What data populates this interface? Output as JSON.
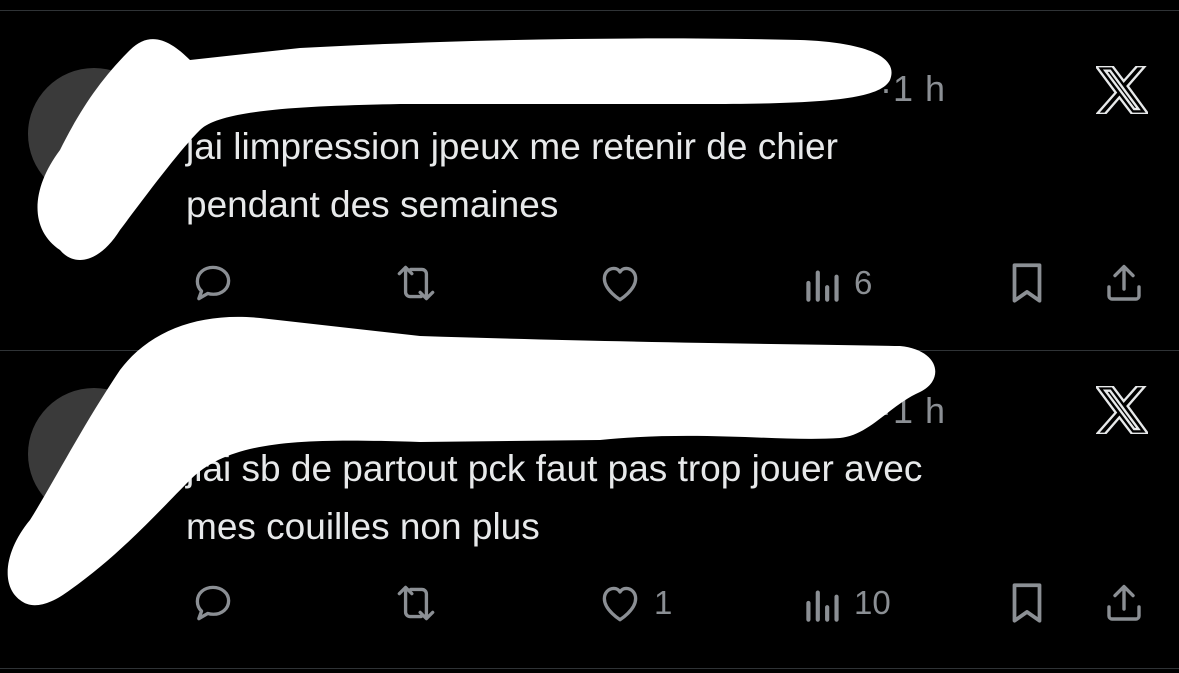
{
  "tweets": [
    {
      "time": "·1 h",
      "text_line1": "jai limpression jpeux me retenir de chier",
      "text_line2": "pendant des semaines",
      "retweets": "",
      "likes": "",
      "views": "6"
    },
    {
      "time": "·1 h",
      "text_line1": "jlai sb de partout pck faut pas trop jouer avec",
      "text_line2": "mes couilles non plus",
      "retweets": "",
      "likes": "1",
      "views": "10"
    }
  ],
  "icons": {
    "reply": "reply-icon",
    "retweet": "retweet-icon",
    "like": "heart-icon",
    "views": "views-icon",
    "bookmark": "bookmark-icon",
    "share": "share-icon",
    "brand": "x-logo-icon"
  },
  "colors": {
    "background": "#000000",
    "text": "#e7e9ea",
    "muted": "#8b8f94",
    "divider": "#2f3336",
    "redaction": "#ffffff"
  }
}
